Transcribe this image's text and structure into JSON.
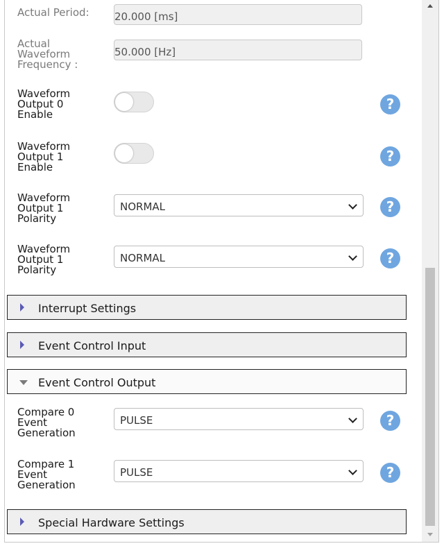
{
  "actual_period": {
    "label": "Actual Period:",
    "value": "20.000 [ms]"
  },
  "actual_freq": {
    "label": "Actual\nWaveform\nFrequency :",
    "value": "50.000 [Hz]"
  },
  "wf0_enable": {
    "label": "Waveform\nOutput 0\nEnable",
    "state": "off"
  },
  "wf1_enable": {
    "label": "Waveform\nOutput 1\nEnable",
    "state": "off"
  },
  "wf1_polarity_a": {
    "label": "Waveform\nOutput 1\nPolarity",
    "value": "NORMAL"
  },
  "wf1_polarity_b": {
    "label": "Waveform\nOutput 1\nPolarity",
    "value": "NORMAL"
  },
  "sections": {
    "interrupt": "Interrupt Settings",
    "event_input": "Event Control Input",
    "event_output": "Event Control Output",
    "special_hw": "Special Hardware Settings"
  },
  "cmp0": {
    "label": "Compare 0\nEvent\nGeneration",
    "value": "PULSE"
  },
  "cmp1": {
    "label": "Compare 1\nEvent\nGeneration",
    "value": "PULSE"
  },
  "help_glyph": "?",
  "colors": {
    "help": "#6fa6e0",
    "expander_icon": "#5b5bb5",
    "section_border": "#222222"
  }
}
